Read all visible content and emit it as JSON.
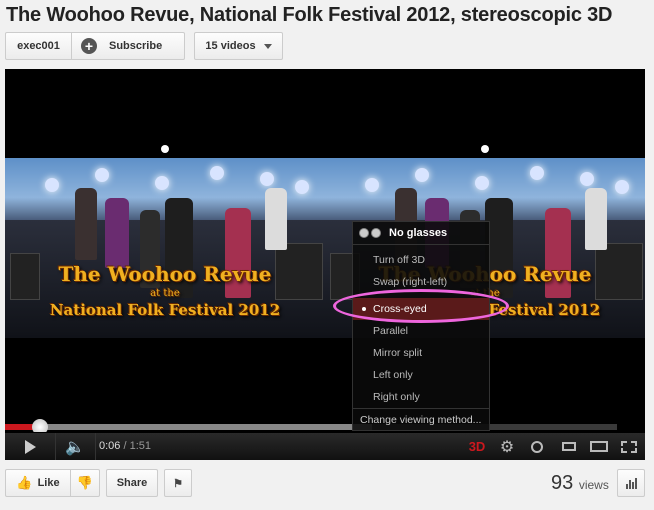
{
  "title": "The Woohoo Revue, National Folk Festival 2012, stereoscopic 3D",
  "channel": {
    "name": "exec001",
    "subscribe_label": "Subscribe",
    "videos_label": "15 videos"
  },
  "video": {
    "banner_line1": "The Woohoo Revue",
    "banner_line2": "at the",
    "banner_line3": "National Folk Festival 2012",
    "progress_fraction": 0.058,
    "buffered_fraction": 0.6
  },
  "controls": {
    "current_time": "0:06",
    "separator": " / ",
    "duration": "1:51",
    "badge_3d": "3D"
  },
  "menu": {
    "header": "No glasses",
    "items": [
      "Turn off 3D",
      "Swap (right-left)",
      "Cross-eyed",
      "Parallel",
      "Mirror split",
      "Left only",
      "Right only"
    ],
    "selected": "Cross-eyed",
    "footer": "Change viewing method..."
  },
  "actions": {
    "like_label": "Like",
    "share_label": "Share"
  },
  "stats": {
    "views_count": "93",
    "views_label": "views"
  },
  "colors": {
    "progress": "#cc181e",
    "badge_3d": "#cc181e",
    "highlight_circle": "#ee66dd",
    "selected_row": "#5a1a1a"
  }
}
